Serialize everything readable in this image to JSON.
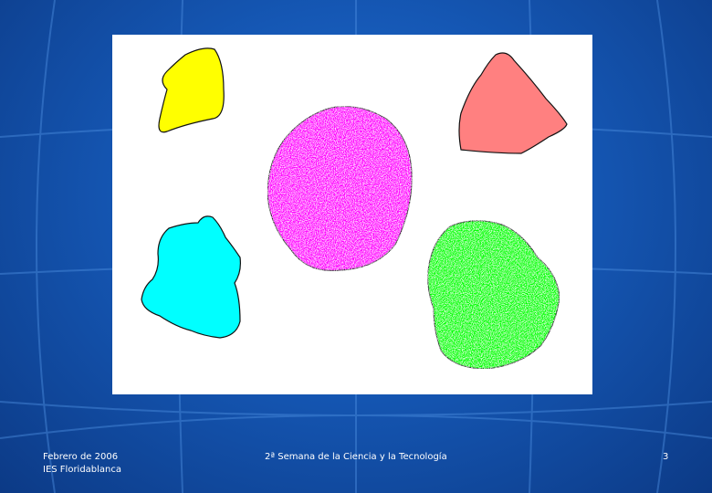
{
  "footer": {
    "date": "Febrero de 2006",
    "school": "IES Floridablanca",
    "event": "2ª Semana de la Ciencia y la Tecnología",
    "page_number": "3"
  },
  "colors": {
    "background": "#1557b4",
    "grid": "#4d8fe0",
    "yellow_blob": "#ffff00",
    "salmon_blob": "#ff8080",
    "magenta_blob": "#ff00ff",
    "cyan_blob": "#00ffff",
    "green_blob": "#00ff00"
  }
}
